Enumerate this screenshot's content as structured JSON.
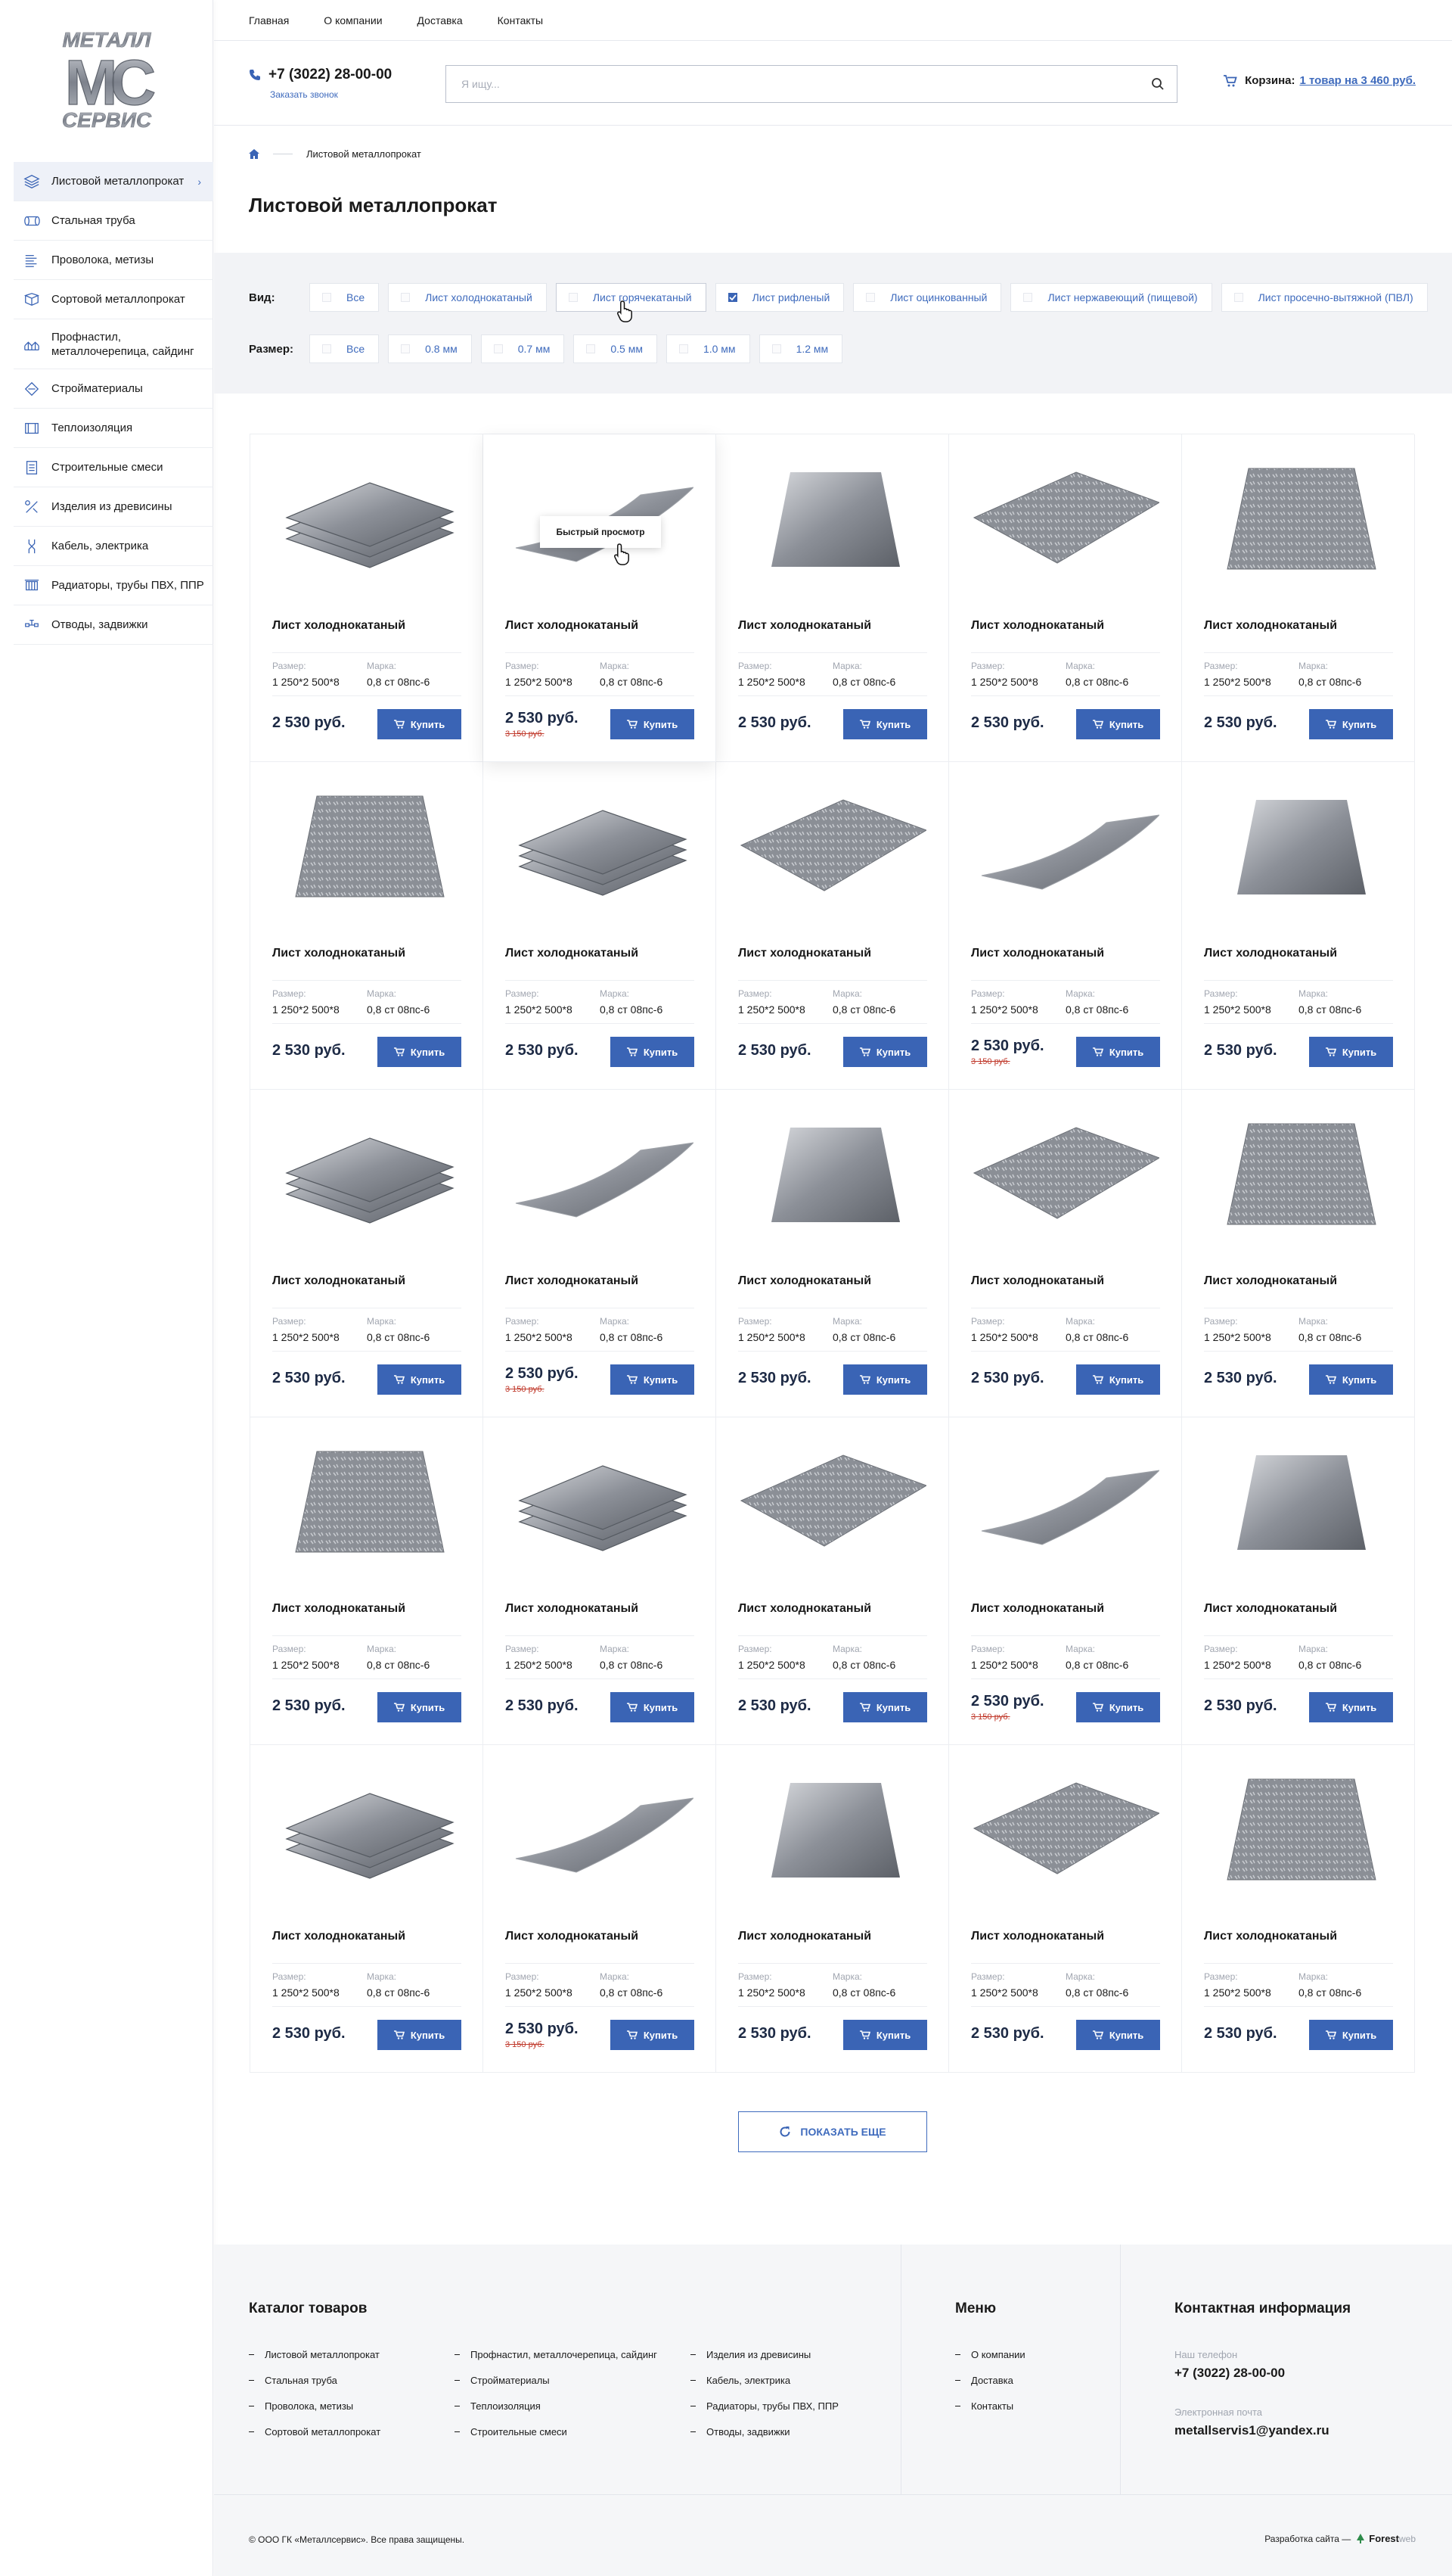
{
  "brand": {
    "logo_line1": "МЕТАЛЛ",
    "logo_mark": "МС",
    "logo_line2": "СЕРВИС"
  },
  "sidebar": {
    "items": [
      {
        "label": "Листовой металлопрокат",
        "icon": "sheets-icon",
        "active": true
      },
      {
        "label": "Стальная труба",
        "icon": "pipe-icon"
      },
      {
        "label": "Проволока, метизы",
        "icon": "wire-icon"
      },
      {
        "label": "Сортовой металлопрокат",
        "icon": "profile-icon"
      },
      {
        "label": "Профнастил, металлочерепица, сайдинг",
        "icon": "roof-icon"
      },
      {
        "label": "Стройматериалы",
        "icon": "materials-icon"
      },
      {
        "label": "Теплоизоляция",
        "icon": "insulation-icon"
      },
      {
        "label": "Строительные смеси",
        "icon": "mix-icon"
      },
      {
        "label": "Изделия из древисины",
        "icon": "wood-icon"
      },
      {
        "label": "Кабель, электрика",
        "icon": "cable-icon"
      },
      {
        "label": "Радиаторы, трубы ПВХ, ППР",
        "icon": "radiator-icon"
      },
      {
        "label": "Отводы, задвижки",
        "icon": "valve-icon"
      }
    ]
  },
  "topnav": [
    "Главная",
    "О компании",
    "Доставка",
    "Контакты"
  ],
  "header": {
    "phone": "+7 (3022) 28-00-00",
    "callback": "Заказать звонок",
    "search_placeholder": "Я ищу...",
    "cart_label": "Корзина:",
    "cart_value": "1 товар на 3 460 руб."
  },
  "breadcrumb": {
    "current": "Листовой металлопрокат"
  },
  "page_title": "Листовой металлопрокат",
  "filters": {
    "type_label": "Вид:",
    "types": [
      {
        "label": "Все",
        "checked": false
      },
      {
        "label": "Лист холоднокатаный",
        "checked": false
      },
      {
        "label": "Лист горячекатаный",
        "checked": false
      },
      {
        "label": "Лист рифленый",
        "checked": true
      },
      {
        "label": "Лист оцинкованный",
        "checked": false
      },
      {
        "label": "Лист нержавеющий (пищевой)",
        "checked": false
      },
      {
        "label": "Лист просечно-вытяжной (ПВЛ)",
        "checked": false
      }
    ],
    "size_label": "Размер:",
    "sizes": [
      {
        "label": "Все"
      },
      {
        "label": "0.8 мм"
      },
      {
        "label": "0.7 мм"
      },
      {
        "label": "0.5 мм"
      },
      {
        "label": "1.0 мм"
      },
      {
        "label": "1.2 мм"
      }
    ]
  },
  "product_common": {
    "name": "Лист холоднокатаный",
    "size_label": "Размер:",
    "size_value": "1 250*2 500*8",
    "grade_label": "Марка:",
    "grade_value": "0,8 ст 08пс-6",
    "price": "2 530 руб.",
    "old_price": "3 150 руб.",
    "buy_label": "Купить"
  },
  "quick_view_label": "Быстрый просмотр",
  "products": [
    {
      "image": "stack",
      "old": false
    },
    {
      "image": "curved",
      "old": true,
      "quickview": true
    },
    {
      "image": "flat",
      "old": false
    },
    {
      "image": "diamond",
      "old": false
    },
    {
      "image": "tread",
      "old": false
    },
    {
      "image": "tread",
      "old": false
    },
    {
      "image": "stack",
      "old": false
    },
    {
      "image": "diamond",
      "old": false
    },
    {
      "image": "curved",
      "old": true
    },
    {
      "image": "flat",
      "old": false
    },
    {
      "image": "stack",
      "old": false
    },
    {
      "image": "curved",
      "old": true
    },
    {
      "image": "flat",
      "old": false
    },
    {
      "image": "diamond",
      "old": false
    },
    {
      "image": "tread",
      "old": false
    },
    {
      "image": "tread",
      "old": false
    },
    {
      "image": "stack",
      "old": false
    },
    {
      "image": "diamond",
      "old": false
    },
    {
      "image": "curved",
      "old": true
    },
    {
      "image": "flat",
      "old": false
    },
    {
      "image": "stack",
      "old": false
    },
    {
      "image": "curved",
      "old": true
    },
    {
      "image": "flat",
      "old": false
    },
    {
      "image": "diamond",
      "old": false
    },
    {
      "image": "tread",
      "old": false
    }
  ],
  "show_more": "ПОКАЗАТЬ ЕЩЕ",
  "footer": {
    "catalog_title": "Каталог товаров",
    "catalog_col1": [
      "Листовой металлопрокат",
      "Стальная труба",
      "Проволока, метизы",
      "Сортовой металлопрокат"
    ],
    "catalog_col2": [
      "Профнастил, металлочерепица, сайдинг",
      "Стройматериалы",
      "Теплоизоляция",
      "Строительные смеси"
    ],
    "catalog_col3": [
      "Изделия из древисины",
      "Кабель, электрика",
      "Радиаторы, трубы ПВХ, ППР",
      "Отводы, задвижки"
    ],
    "menu_title": "Меню",
    "menu": [
      "О компании",
      "Доставка",
      "Контакты"
    ],
    "contact_title": "Контактная информация",
    "phone_label": "Наш телефон",
    "phone": "+7 (3022) 28-00-00",
    "email_label": "Электронная почта",
    "email": "metallservis1@yandex.ru",
    "copyright": "© ООО ГК «Металлсервис». Все права защищены.",
    "dev_label": "Разработка сайта —",
    "dev_name": "Forest",
    "dev_suffix": "web"
  },
  "colors": {
    "accent": "#3a64b5",
    "price": "#1d2a45",
    "old_price": "#c0392b",
    "filter_bg": "#f2f3f6"
  }
}
